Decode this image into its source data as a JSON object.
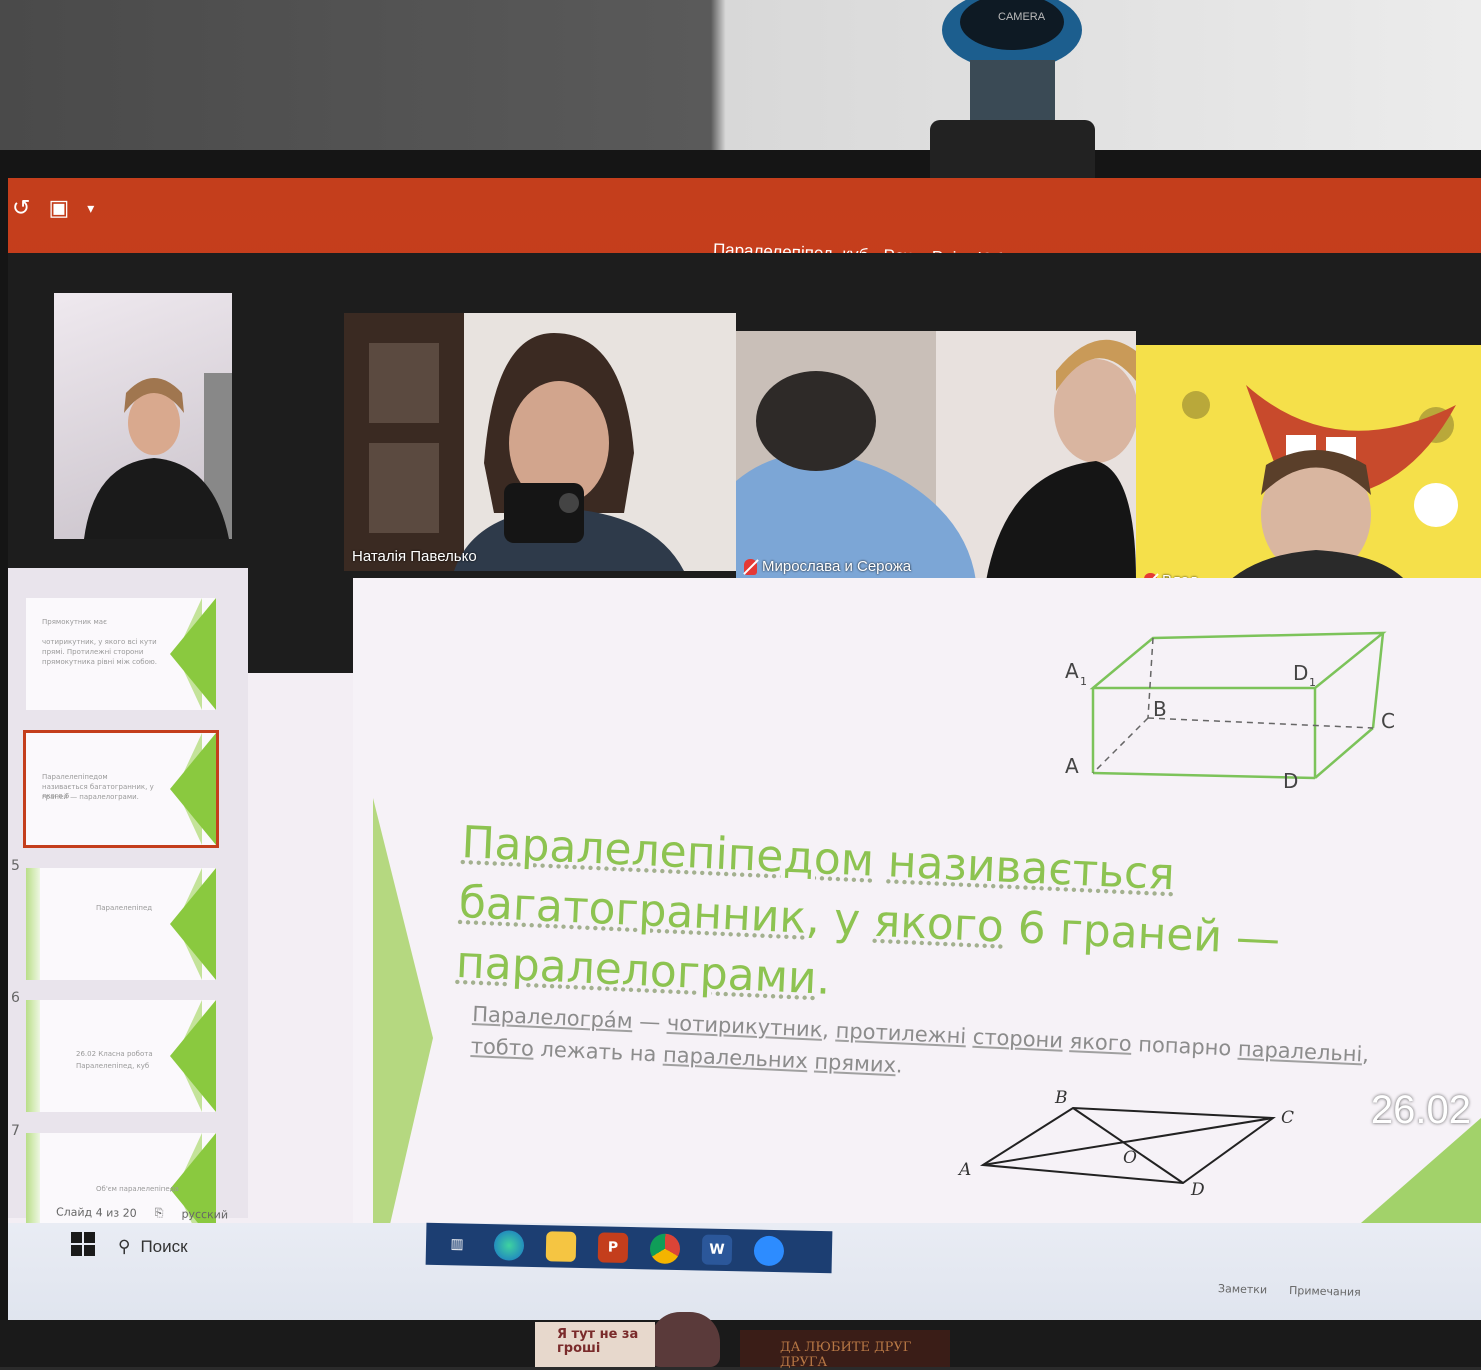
{
  "window": {
    "title": "Паралелепіпед, куб - PowerPoint (Сбой активации продукта)"
  },
  "webcam": {
    "label": "CAMERA"
  },
  "participants": [
    {
      "name": "",
      "muted": false
    },
    {
      "name": "Наталія Павелько",
      "muted": false
    },
    {
      "name": "Мирослава и Серожа",
      "muted": true
    },
    {
      "name": "Влад",
      "muted": true
    }
  ],
  "thumbnails": [
    {
      "number": "",
      "lines": [
        "Прямокутник має",
        "чотирикутник, у якого всі кути",
        "прямі. Протилежні сторони",
        "прямокутника рівні між собою."
      ]
    },
    {
      "number": "",
      "lines": [
        "Паралелепіпедом",
        "називається багатогранник, у якого 6",
        "граней — паралелограми."
      ]
    },
    {
      "number": "5",
      "lines": [
        "Паралелепіпед"
      ]
    },
    {
      "number": "6",
      "lines": [
        "26.02 Класна робота",
        "Паралелепіпед, куб"
      ]
    },
    {
      "number": "7",
      "lines": [
        "Об'єм паралелепіпеда"
      ]
    }
  ],
  "slide": {
    "headline_words": [
      {
        "t": "Паралелепіпедом",
        "u": true
      },
      {
        "t": " ",
        "u": false
      },
      {
        "t": "називається",
        "u": true
      },
      {
        "t": " ",
        "u": false
      },
      {
        "t": "багатогранник",
        "u": true
      },
      {
        "t": ", у ",
        "u": false
      },
      {
        "t": "якого",
        "u": true
      },
      {
        "t": " 6 граней — ",
        "u": false
      },
      {
        "t": "паралелограми",
        "u": true
      },
      {
        "t": ".",
        "u": false
      }
    ],
    "definition_words": [
      {
        "t": "Паралелогра́м",
        "u": true
      },
      {
        "t": " — ",
        "u": false
      },
      {
        "t": "чотирикутник",
        "u": true
      },
      {
        "t": ", ",
        "u": false
      },
      {
        "t": "протилежні",
        "u": true
      },
      {
        "t": " ",
        "u": false
      },
      {
        "t": "сторони",
        "u": true
      },
      {
        "t": " ",
        "u": false
      },
      {
        "t": "якого",
        "u": true
      },
      {
        "t": " попарно ",
        "u": false
      },
      {
        "t": "паралельні",
        "u": true
      },
      {
        "t": ", ",
        "u": false
      },
      {
        "t": "тобто",
        "u": true
      },
      {
        "t": " лежать на ",
        "u": false
      },
      {
        "t": "паралельних",
        "u": true
      },
      {
        "t": " ",
        "u": false
      },
      {
        "t": "прямих",
        "u": true
      },
      {
        "t": ".",
        "u": false
      }
    ],
    "box_labels": {
      "a1": "A",
      "a1_sub": "1",
      "b": "B",
      "d1": "D",
      "d1_sub": "1",
      "c": "C",
      "a": "A",
      "d": "D"
    },
    "para_labels": {
      "b": "B",
      "c": "C",
      "a": "A",
      "o": "O",
      "d": "D"
    },
    "colors": {
      "headline": "#8dc351",
      "accent": "#c43e1c",
      "box_stroke": "#7cc35a"
    }
  },
  "statusbar": {
    "slide_count": "Слайд 4 из 20",
    "language": "русский"
  },
  "taskbar": {
    "search_placeholder": "Поиск",
    "notes_label": "Заметки",
    "comments_label": "Примечания",
    "clock": "26.02",
    "icons": [
      "task-view-icon",
      "edge-icon",
      "file-explorer-icon",
      "powerpoint-icon",
      "chrome-icon",
      "word-icon",
      "zoom-icon"
    ]
  },
  "desk": {
    "sticker_text": "Я тут не за гроші",
    "plaque_text": "ДА ЛЮБИТЕ ДРУГ ДРУГА"
  }
}
